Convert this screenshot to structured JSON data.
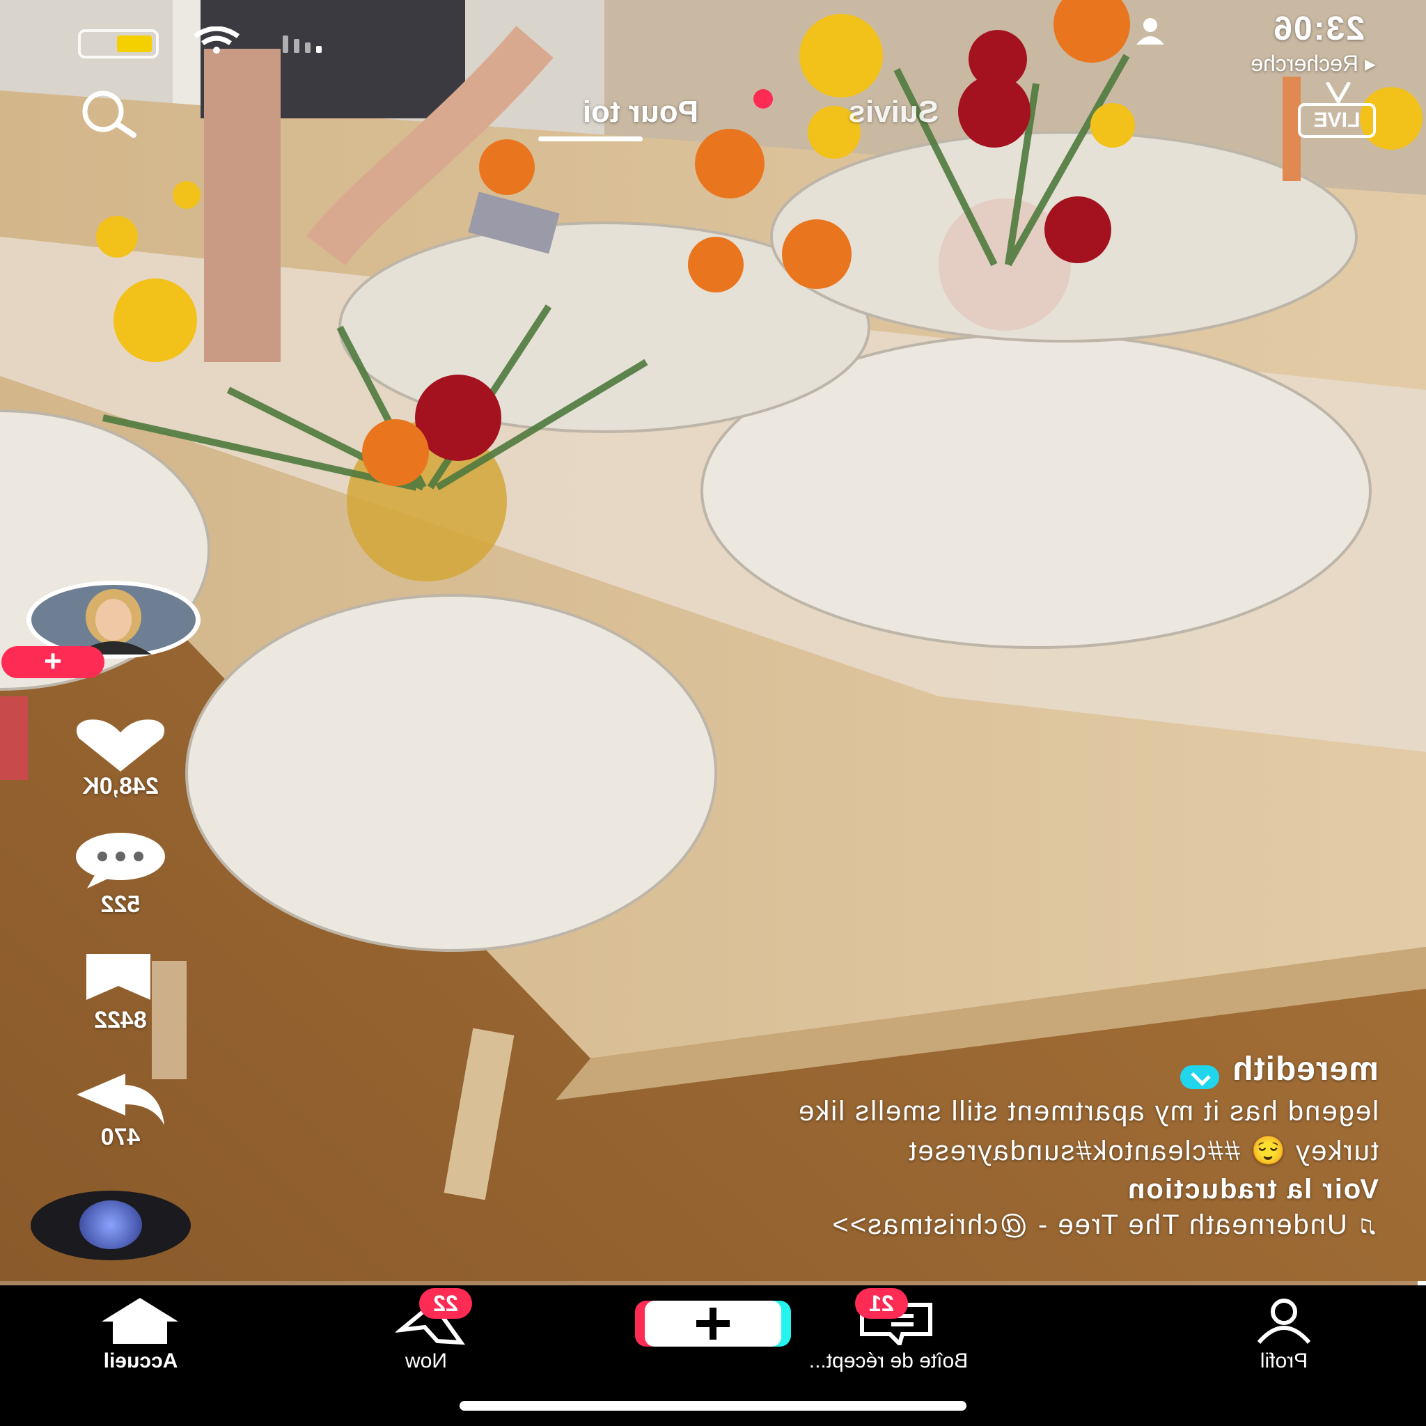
{
  "status_bar": {
    "time": "23:06",
    "back_link": "◂ Recherche"
  },
  "top_tabs": {
    "live": "LIVE",
    "following": "Suivis",
    "for_you": "Pour toi"
  },
  "actions": {
    "likes": "248,0K",
    "comments": "522",
    "bookmarks": "8422",
    "shares": "470"
  },
  "caption": {
    "username": "meredith",
    "line1": "legend has it my apartment still smells like",
    "line2": "turkey 😌 ##cleantok#sundayreset",
    "translate": "Voir la traduction",
    "music": "Underneath The Tree - @christmas>>"
  },
  "nav": {
    "home": "Accueil",
    "now": "Now",
    "now_badge": "22",
    "inbox": "Boîte de récept...",
    "inbox_badge": "21",
    "profile": "Profil"
  },
  "colors": {
    "accent": "#fe2c55",
    "verified": "#20d5ec",
    "create_cyan": "#25f4ee"
  }
}
